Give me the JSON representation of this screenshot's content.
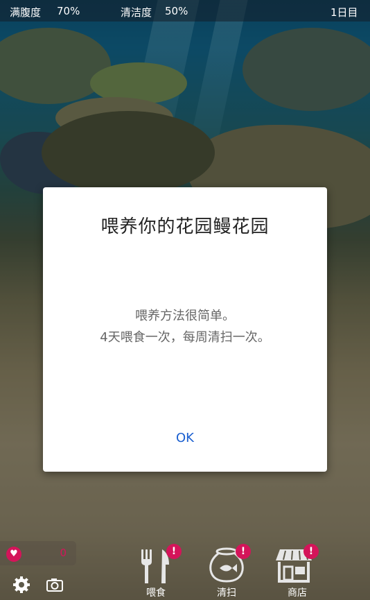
{
  "status": {
    "fullness_label": "满腹度",
    "fullness_value": "70%",
    "cleanliness_label": "清洁度",
    "cleanliness_value": "50%",
    "day": "1日目"
  },
  "dialog": {
    "title": "喂养你的花园鳗花园",
    "message_line1": "喂养方法很简单。",
    "message_line2": "4天喂食一次，每周清扫一次。",
    "ok_label": "OK"
  },
  "likes": {
    "count": "0"
  },
  "nav": {
    "feed_label": "喂食",
    "clean_label": "清扫",
    "shop_label": "商店",
    "badge": "!"
  },
  "icons": [
    "heart-icon",
    "gear-icon",
    "camera-icon",
    "fork-knife-icon",
    "fishbowl-icon",
    "shop-icon"
  ],
  "colors": {
    "accent": "#d4145a",
    "ok_text": "#1a5fd0",
    "dialog_bg": "#ffffff"
  }
}
